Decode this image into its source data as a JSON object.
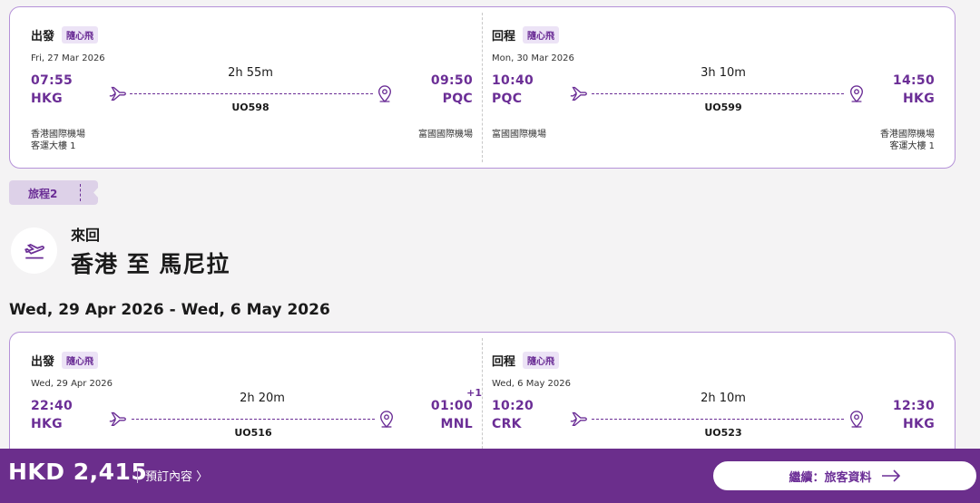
{
  "trip1": {
    "outbound": {
      "label": "出發",
      "badge": "隨心飛",
      "date": "Fri, 27 Mar 2026",
      "dep_time": "07:55",
      "dep_code": "HKG",
      "duration": "2h 55m",
      "flight": "UO598",
      "arr_time": "09:50",
      "arr_code": "PQC",
      "dep_airport_line1": "香港國際機場",
      "dep_airport_line2": "客運大樓 1",
      "arr_airport_line1": "富國國際機場"
    },
    "inbound": {
      "label": "回程",
      "badge": "隨心飛",
      "date": "Mon, 30 Mar 2026",
      "dep_time": "10:40",
      "dep_code": "PQC",
      "duration": "3h 10m",
      "flight": "UO599",
      "arr_time": "14:50",
      "arr_code": "HKG",
      "dep_airport_line1": "富國國際機場",
      "arr_airport_line1": "香港國際機場",
      "arr_airport_line2": "客運大樓 1"
    }
  },
  "trip2": {
    "tab_label": "旅程2",
    "route_type": "來回",
    "route_title": "香港 至 馬尼拉",
    "date_range": "Wed, 29 Apr 2026 - Wed, 6 May 2026",
    "outbound": {
      "label": "出發",
      "badge": "隨心飛",
      "date": "Wed, 29 Apr 2026",
      "dep_time": "22:40",
      "dep_code": "HKG",
      "duration": "2h 20m",
      "flight": "UO516",
      "arr_time": "01:00",
      "arr_code": "MNL",
      "day_offset": "+1"
    },
    "inbound": {
      "label": "回程",
      "badge": "隨心飛",
      "date": "Wed, 6 May 2026",
      "dep_time": "10:20",
      "dep_code": "CRK",
      "duration": "2h 10m",
      "flight": "UO523",
      "arr_time": "12:30",
      "arr_code": "HKG"
    }
  },
  "footer": {
    "price": "HKD 2,415",
    "details_label": "預訂內容 〉",
    "continue_label": "繼續：旅客資料"
  },
  "colors": {
    "accent": "#6b2e96",
    "footer_bg": "#6b2e8c",
    "badge_bg": "#ece3f6"
  },
  "icons": {
    "departure": "plane-icon",
    "arrival": "location-pin-icon",
    "route": "plane-takeoff-icon",
    "continue": "arrow-right-icon"
  }
}
